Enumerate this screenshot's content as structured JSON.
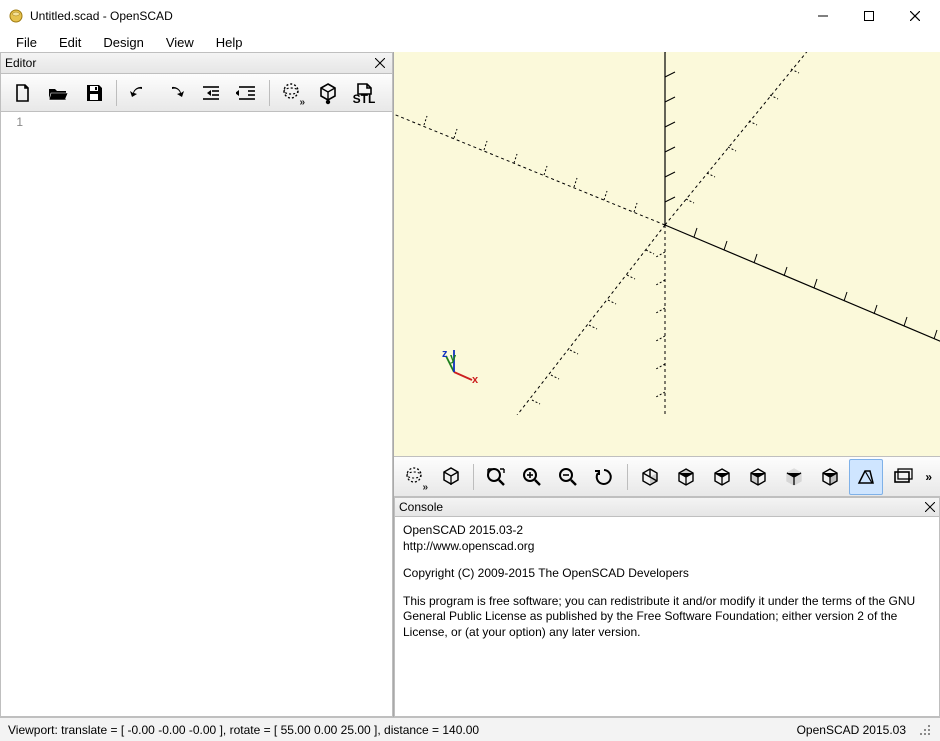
{
  "window": {
    "title": "Untitled.scad - OpenSCAD"
  },
  "menu": {
    "file": "File",
    "edit": "Edit",
    "design": "Design",
    "view": "View",
    "help": "Help"
  },
  "editor": {
    "panel_title": "Editor",
    "line1": "1"
  },
  "console": {
    "panel_title": "Console",
    "l1": "OpenSCAD 2015.03-2",
    "l2": "http://www.openscad.org",
    "l3": "Copyright (C) 2009-2015 The OpenSCAD Developers",
    "l4": "This program is free software; you can redistribute it and/or modify it under the terms of the GNU General Public License as published by the Free Software Foundation; either version 2 of the License, or (at your option) any later version."
  },
  "viewport_axes": {
    "z": "z",
    "y": "y",
    "x": "x"
  },
  "status": {
    "left": "Viewport: translate = [ -0.00 -0.00 -0.00 ], rotate = [ 55.00 0.00 25.00 ], distance = 140.00",
    "right": "OpenSCAD 2015.03"
  },
  "toolbar_labels": {
    "stl": "STL"
  }
}
